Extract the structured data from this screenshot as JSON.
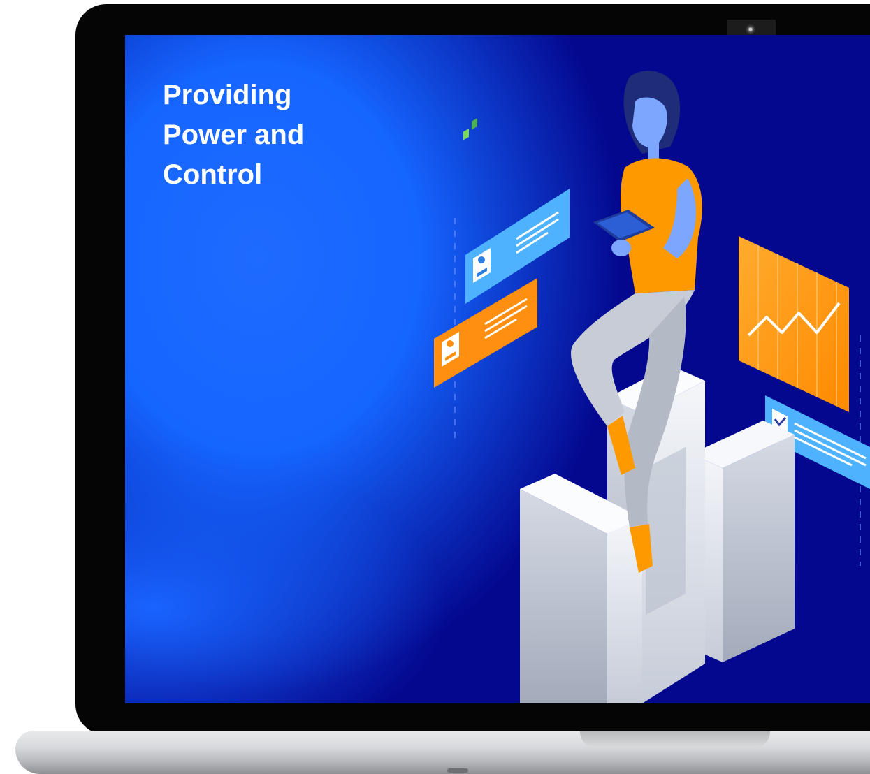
{
  "screen": {
    "headline_lines": [
      "Providing",
      "Power and",
      "Control"
    ]
  },
  "colors": {
    "bezel": "#050505",
    "screen_dark_blue": "#04088f",
    "screen_bright_blue": "#1f6bff",
    "accent_orange": "#ff9900",
    "card_blue": "#4fb2ff",
    "pillar_white": "#e8ebf2"
  },
  "illustration": {
    "icons": [
      "person-card-icon",
      "checkmark-icon",
      "line-chart-icon",
      "tablet-icon"
    ]
  }
}
